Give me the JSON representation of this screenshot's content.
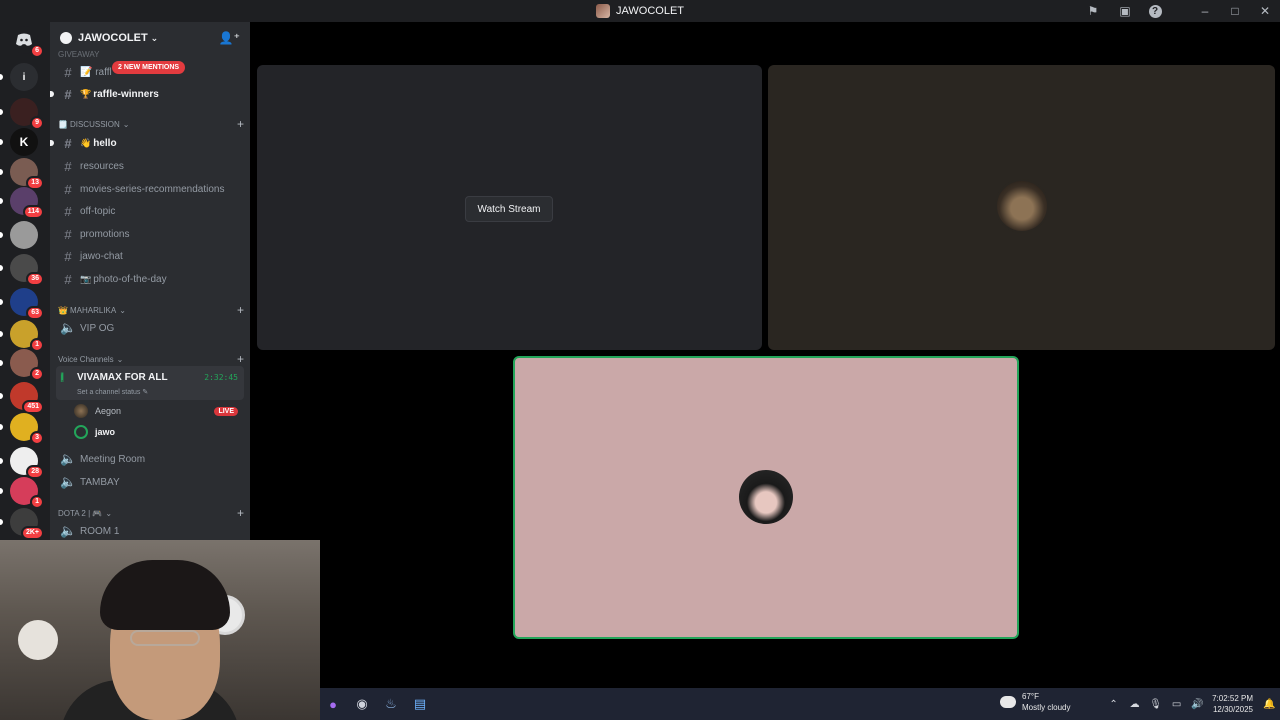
{
  "window": {
    "title": "JAWOCOLET",
    "title_icons": [
      "flag-icon",
      "inbox-icon",
      "help-icon",
      "minimize-icon",
      "maximize-icon",
      "close-icon"
    ]
  },
  "rail": {
    "home_badge": "6",
    "items": [
      {
        "label": "i",
        "badge": "",
        "color": "#2b2d31"
      },
      {
        "label": "",
        "badge": "9",
        "color": "#3a2020"
      },
      {
        "label": "K",
        "badge": "",
        "color": "#111"
      },
      {
        "label": "",
        "badge": "13",
        "color": "#7a5c52"
      },
      {
        "label": "",
        "badge": "114",
        "color": "#5a3f6a"
      },
      {
        "label": "",
        "badge": "",
        "color": "#9a9a9a"
      },
      {
        "label": "",
        "badge": "36",
        "color": "#4a4a4a"
      },
      {
        "label": "",
        "badge": "63",
        "color": "#1f3f8a"
      },
      {
        "label": "",
        "badge": "1",
        "color": "#c9a12b"
      },
      {
        "label": "",
        "badge": "2",
        "color": "#8a5b4e"
      },
      {
        "label": "",
        "badge": "451",
        "color": "#c0392b"
      },
      {
        "label": "",
        "badge": "3",
        "color": "#e0b020"
      },
      {
        "label": "",
        "badge": "28",
        "color": "#eeeeee"
      },
      {
        "label": "",
        "badge": "1",
        "color": "#d63d5a"
      },
      {
        "label": "",
        "badge": "2K+",
        "color": "#3d3d3d"
      }
    ]
  },
  "sidebar": {
    "server_name": "JAWOCOLET",
    "mention_pill": "2 NEW MENTIONS",
    "top_channel_partial": "📝 raffl",
    "category_partial": "GIVEAWAY",
    "channels_top": [
      {
        "name": "raffle-winners",
        "emoji": "🏆",
        "bold": true
      }
    ],
    "discussion_label": "DISCUSSION",
    "discussion_emoji": "🗒️",
    "discussion_channels": [
      {
        "name": "hello",
        "emoji": "👋",
        "bold": true
      },
      {
        "name": "resources",
        "emoji": "",
        "bold": false
      },
      {
        "name": "movies-series-recommendations",
        "emoji": "",
        "bold": false
      },
      {
        "name": "off-topic",
        "emoji": "",
        "bold": false
      },
      {
        "name": "promotions",
        "emoji": "",
        "bold": false
      },
      {
        "name": "jawo-chat",
        "emoji": "",
        "bold": false
      },
      {
        "name": "photo-of-the-day",
        "emoji": "📷",
        "bold": false
      }
    ],
    "maharlika_label": "MAHARLIKA",
    "maharlika_emoji": "👑",
    "vip_channel": "VIP OG",
    "voice_label": "Voice Channels",
    "active_voice": {
      "name": "VIVAMAX FOR ALL",
      "timer": "2:32:45",
      "status": "Set a channel status ✎"
    },
    "voice_users": [
      {
        "name": "Aegon",
        "live": "LIVE"
      },
      {
        "name": "jawo",
        "live": ""
      }
    ],
    "other_voice": [
      "Meeting Room",
      "TAMBAY"
    ],
    "dota_label": "DOTA 2 | 🎮",
    "dota_room": "ROOM 1"
  },
  "stage": {
    "watch_stream": "Watch Stream"
  },
  "taskbar": {
    "weather_temp": "67°F",
    "weather_desc": "Mostly cloudy",
    "time": "7:02:52 PM",
    "date": "12/30/2025"
  }
}
